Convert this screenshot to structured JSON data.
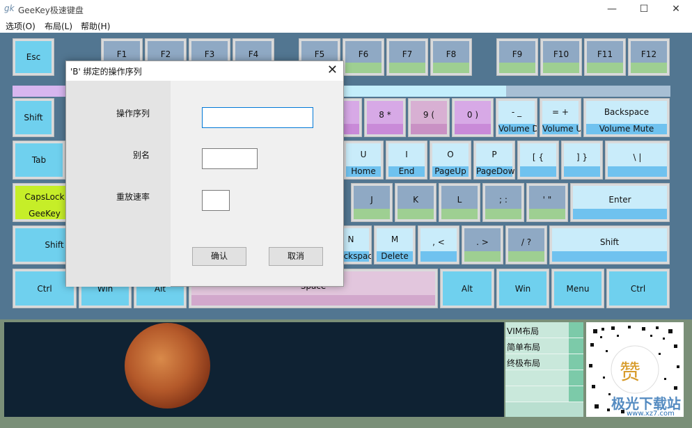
{
  "window": {
    "title": "GeeKey极速键盘",
    "icon": "gk",
    "minimize": "—",
    "maximize": "☐",
    "close": "✕"
  },
  "menu": [
    {
      "label": "选项(O)"
    },
    {
      "label": "布局(L)"
    },
    {
      "label": "帮助(H)"
    }
  ],
  "keyboard": {
    "keys": [
      {
        "id": "esc",
        "l1": "Esc",
        "l2": "",
        "color": "#6fd0ee",
        "bar": ""
      },
      {
        "id": "f1",
        "l1": "F1",
        "l2": "",
        "color": "#8fa9c4",
        "bar": "#9ecf92"
      },
      {
        "id": "f2",
        "l1": "F2",
        "l2": "",
        "color": "#8fa9c4",
        "bar": "#9ecf92"
      },
      {
        "id": "f3",
        "l1": "F3",
        "l2": "",
        "color": "#8fa9c4",
        "bar": "#9ecf92"
      },
      {
        "id": "f4",
        "l1": "F4",
        "l2": "",
        "color": "#8fa9c4",
        "bar": "#9ecf92"
      },
      {
        "id": "f5",
        "l1": "F5",
        "l2": "",
        "color": "#8fa9c4",
        "bar": "#9ecf92"
      },
      {
        "id": "f6",
        "l1": "F6",
        "l2": "",
        "color": "#8fa9c4",
        "bar": "#9ecf92"
      },
      {
        "id": "f7",
        "l1": "F7",
        "l2": "",
        "color": "#8fa9c4",
        "bar": "#9ecf92"
      },
      {
        "id": "f8",
        "l1": "F8",
        "l2": "",
        "color": "#8fa9c4",
        "bar": "#9ecf92"
      },
      {
        "id": "f9",
        "l1": "F9",
        "l2": "",
        "color": "#8fa9c4",
        "bar": "#9ecf92"
      },
      {
        "id": "f10",
        "l1": "F10",
        "l2": "",
        "color": "#8fa9c4",
        "bar": "#9ecf92"
      },
      {
        "id": "f11",
        "l1": "F11",
        "l2": "",
        "color": "#8fa9c4",
        "bar": "#9ecf92"
      },
      {
        "id": "f12",
        "l1": "F12",
        "l2": "",
        "color": "#8fa9c4",
        "bar": "#9ecf92"
      },
      {
        "id": "shift-l",
        "l1": "Shift",
        "l2": "",
        "color": "#6fd0ee",
        "bar": ""
      },
      {
        "id": "amp",
        "l1": "&",
        "l2": "",
        "color": "#d7a9e6",
        "bar": "#c98ad8"
      },
      {
        "id": "8",
        "l1": "8  *",
        "l2": "",
        "color": "#d7a9e6",
        "bar": "#c98ad8"
      },
      {
        "id": "9",
        "l1": "9  (",
        "l2": "",
        "color": "#d8b0d3",
        "bar": "#c991c4"
      },
      {
        "id": "0",
        "l1": "0  )",
        "l2": "",
        "color": "#d7a9e6",
        "bar": "#c98ad8"
      },
      {
        "id": "minus",
        "l1": "-  _",
        "l2": "Volume Down",
        "color": "#c9ecfa",
        "bar": "#6fc2ef"
      },
      {
        "id": "equal",
        "l1": "=  +",
        "l2": "Volume Up",
        "color": "#c9ecfa",
        "bar": "#6fc2ef"
      },
      {
        "id": "backspace",
        "l1": "Backspace",
        "l2": "Volume Mute",
        "color": "#c9ecfa",
        "bar": "#6fc2ef"
      },
      {
        "id": "tab",
        "l1": "Tab",
        "l2": "",
        "color": "#6fd0ee",
        "bar": ""
      },
      {
        "id": "u",
        "l1": "U",
        "l2": "Home",
        "color": "#c9ecfa",
        "bar": "#6fc2ef"
      },
      {
        "id": "i",
        "l1": "I",
        "l2": "End",
        "color": "#c9ecfa",
        "bar": "#6fc2ef"
      },
      {
        "id": "o",
        "l1": "O",
        "l2": "PageUp",
        "color": "#c9ecfa",
        "bar": "#6fc2ef"
      },
      {
        "id": "p",
        "l1": "P",
        "l2": "PageDown",
        "color": "#c9ecfa",
        "bar": "#6fc2ef"
      },
      {
        "id": "lbracket",
        "l1": "[  {",
        "l2": "",
        "color": "#c9ecfa",
        "bar": "#6fc2ef"
      },
      {
        "id": "rbracket",
        "l1": "]  }",
        "l2": "",
        "color": "#c9ecfa",
        "bar": "#6fc2ef"
      },
      {
        "id": "backslash",
        "l1": "\\  |",
        "l2": "",
        "color": "#c9ecfa",
        "bar": "#6fc2ef"
      },
      {
        "id": "capslock",
        "l1": "CapsLock",
        "l2": "GeeKey",
        "color": "#c6ee28",
        "bar": ""
      },
      {
        "id": "j",
        "l1": "J",
        "l2": "",
        "color": "#8fa9c4",
        "bar": "#9ecf92"
      },
      {
        "id": "k",
        "l1": "K",
        "l2": "",
        "color": "#8fa9c4",
        "bar": "#9ecf92"
      },
      {
        "id": "l",
        "l1": "L",
        "l2": "",
        "color": "#8fa9c4",
        "bar": "#9ecf92"
      },
      {
        "id": "semicolon",
        "l1": ";  :",
        "l2": "",
        "color": "#8fa9c4",
        "bar": "#9ecf92"
      },
      {
        "id": "quote",
        "l1": "'  \"",
        "l2": "",
        "color": "#8fa9c4",
        "bar": "#9ecf92"
      },
      {
        "id": "enter",
        "l1": "Enter",
        "l2": "",
        "color": "#c9ecfa",
        "bar": "#6fc2ef"
      },
      {
        "id": "shift-l2",
        "l1": "Shift",
        "l2": "",
        "color": "#6fd0ee",
        "bar": ""
      },
      {
        "id": "n",
        "l1": "N",
        "l2": "Backspace",
        "color": "#c9ecfa",
        "bar": "#6fc2ef"
      },
      {
        "id": "m",
        "l1": "M",
        "l2": "Delete",
        "color": "#c9ecfa",
        "bar": "#6fc2ef"
      },
      {
        "id": "comma",
        "l1": ",  <",
        "l2": "",
        "color": "#c9ecfa",
        "bar": "#6fc2ef"
      },
      {
        "id": "period",
        "l1": ".  >",
        "l2": "",
        "color": "#8fa9c4",
        "bar": "#9ecf92"
      },
      {
        "id": "slash",
        "l1": "/  ?",
        "l2": "",
        "color": "#8fa9c4",
        "bar": "#9ecf92"
      },
      {
        "id": "shift-r",
        "l1": "Shift",
        "l2": "",
        "color": "#c9ecfa",
        "bar": "#6fc2ef"
      },
      {
        "id": "ctrl-l",
        "l1": "Ctrl",
        "l2": "",
        "color": "#6fd0ee",
        "bar": ""
      },
      {
        "id": "win-l",
        "l1": "Win",
        "l2": "",
        "color": "#6fd0ee",
        "bar": ""
      },
      {
        "id": "alt-l",
        "l1": "Alt",
        "l2": "",
        "color": "#6fd0ee",
        "bar": ""
      },
      {
        "id": "space",
        "l1": "Space",
        "l2": "",
        "color": "#e2c6dd",
        "bar": "#d2a8cc"
      },
      {
        "id": "alt-r",
        "l1": "Alt",
        "l2": "",
        "color": "#6fd0ee",
        "bar": ""
      },
      {
        "id": "win-r",
        "l1": "Win",
        "l2": "",
        "color": "#6fd0ee",
        "bar": ""
      },
      {
        "id": "menu",
        "l1": "Menu",
        "l2": "",
        "color": "#6fd0ee",
        "bar": ""
      },
      {
        "id": "ctrl-r",
        "l1": "Ctrl",
        "l2": "",
        "color": "#6fd0ee",
        "bar": ""
      }
    ],
    "number_bar_colors": [
      "#d7b6ef",
      "#c3eefb",
      "#a7bfd4"
    ]
  },
  "dialog": {
    "title": "'B' 绑定的操作序列",
    "close": "✕",
    "fields": [
      {
        "label": "操作序列",
        "value": ""
      },
      {
        "label": "别名",
        "value": ""
      },
      {
        "label": "重放速率",
        "value": ""
      }
    ],
    "ok": "确认",
    "cancel": "取消"
  },
  "layouts": [
    {
      "label": "VIM布局"
    },
    {
      "label": "简单布局"
    },
    {
      "label": "终极布局"
    },
    {
      "label": ""
    },
    {
      "label": ""
    }
  ],
  "qr": {
    "center_glyph": "赞"
  },
  "watermark": {
    "text": "极光下载站",
    "sub": "www.xz7.com"
  }
}
